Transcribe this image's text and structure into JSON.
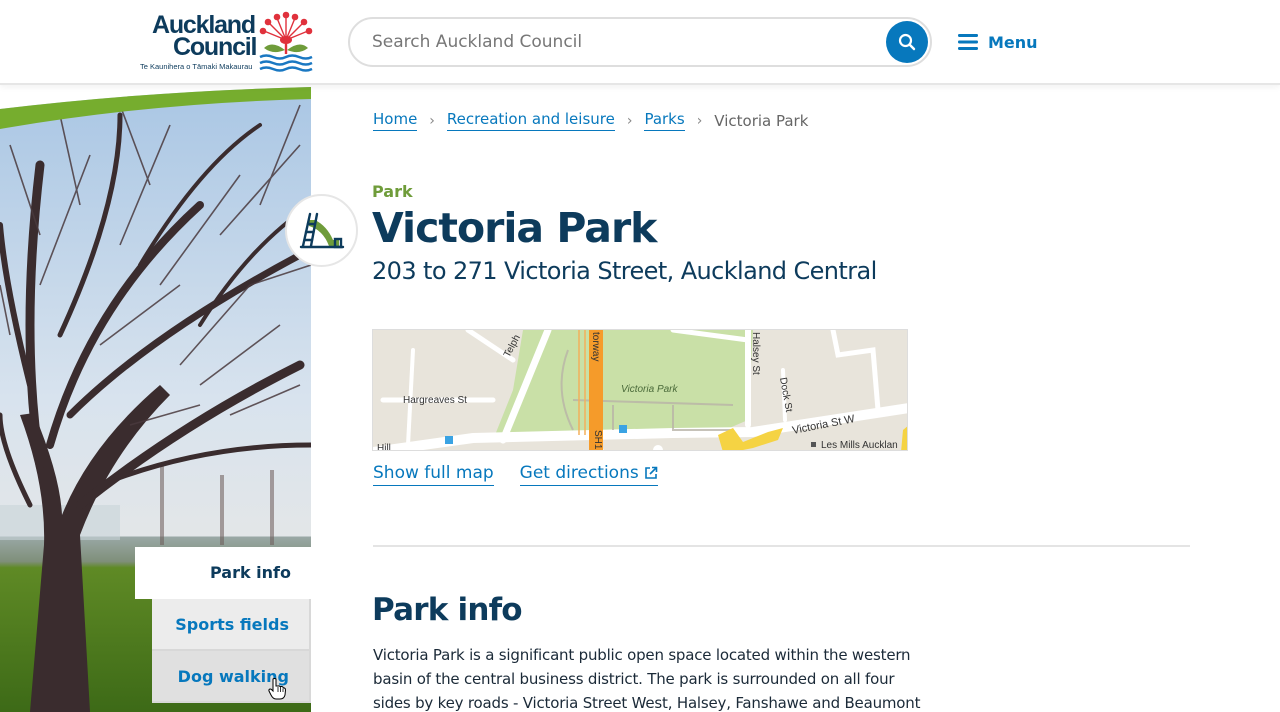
{
  "header": {
    "logo": {
      "line1": "Auckland",
      "line2": "Council",
      "tagline": "Te Kaunihera o Tāmaki Makaurau"
    },
    "search": {
      "placeholder": "Search Auckland Council",
      "value": "",
      "button_icon": "search-icon"
    },
    "menu": {
      "icon": "hamburger-icon",
      "label": "Menu"
    }
  },
  "colors": {
    "brand_blue": "#0778bd",
    "navy": "#0d3b5c",
    "park_green": "#6f9c3a"
  },
  "breadcrumb": [
    {
      "label": "Home",
      "link": true
    },
    {
      "label": "Recreation and leisure",
      "link": true
    },
    {
      "label": "Parks",
      "link": true
    },
    {
      "label": "Victoria Park",
      "link": false
    }
  ],
  "page": {
    "category": "Park",
    "category_icon": "playground-slide-icon",
    "title": "Victoria Park",
    "address": "203 to 271 Victoria Street, Auckland Central"
  },
  "map": {
    "labels": {
      "park": "Victoria Park",
      "hargreaves": "Hargreaves St",
      "telph": "Telph",
      "motorway": "torway",
      "halsey": "Halsey St",
      "dock": "Dock St",
      "victoria_st_w": "Victoria St W",
      "les_mills": "Les Mills Aucklan",
      "hill": "Hill",
      "sh": "SH1"
    },
    "links": {
      "show_full_map": "Show full map",
      "get_directions": "Get directions"
    }
  },
  "sidenav": {
    "tabs": [
      {
        "label": "Park info",
        "active": true
      },
      {
        "label": "Sports fields",
        "active": false
      },
      {
        "label": "Dog walking",
        "active": false
      }
    ]
  },
  "section": {
    "title": "Park info",
    "body_lines": [
      "Victoria Park is a significant public open space located within the western",
      "basin of the central business district. The park is surrounded on all four",
      "sides by key roads - Victoria Street West, Halsey, Fanshawe and Beaumont"
    ]
  }
}
